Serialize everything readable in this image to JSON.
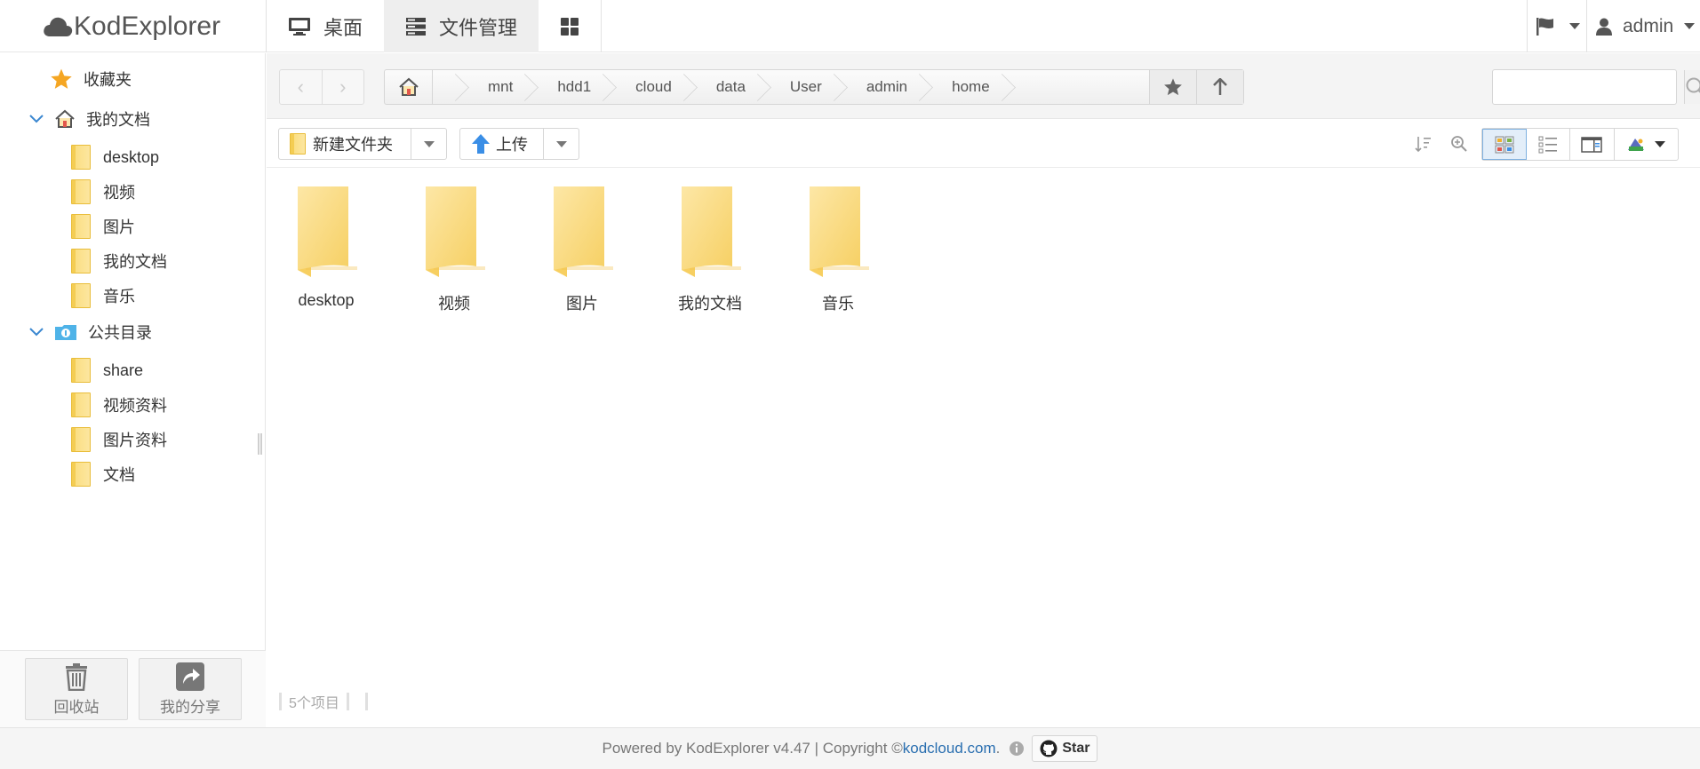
{
  "app": {
    "name": "KodExplorer"
  },
  "nav": {
    "desktop": "桌面",
    "file_manager": "文件管理",
    "user": "admin"
  },
  "sidebar": {
    "favorites": "收藏夹",
    "my_docs": {
      "label": "我的文档",
      "children": [
        "desktop",
        "视频",
        "图片",
        "我的文档",
        "音乐"
      ]
    },
    "public": {
      "label": "公共目录",
      "children": [
        "share",
        "视频资料",
        "图片资料",
        "文档"
      ]
    },
    "recycle": "回收站",
    "my_share": "我的分享"
  },
  "path": {
    "crumbs": [
      "mnt",
      "hdd1",
      "cloud",
      "data",
      "User",
      "admin",
      "home"
    ]
  },
  "search": {
    "placeholder": ""
  },
  "toolbar": {
    "new_folder": "新建文件夹",
    "upload": "上传"
  },
  "files": [
    "desktop",
    "视频",
    "图片",
    "我的文档",
    "音乐"
  ],
  "status": {
    "count": "5个项目"
  },
  "footer": {
    "text": "Powered by KodExplorer v4.47 | Copyright © ",
    "link": "kodcloud.com",
    "dot": ".",
    "star": "Star"
  },
  "colors": {
    "folder": "#fbdf84",
    "accent": "#2a6fb0"
  }
}
